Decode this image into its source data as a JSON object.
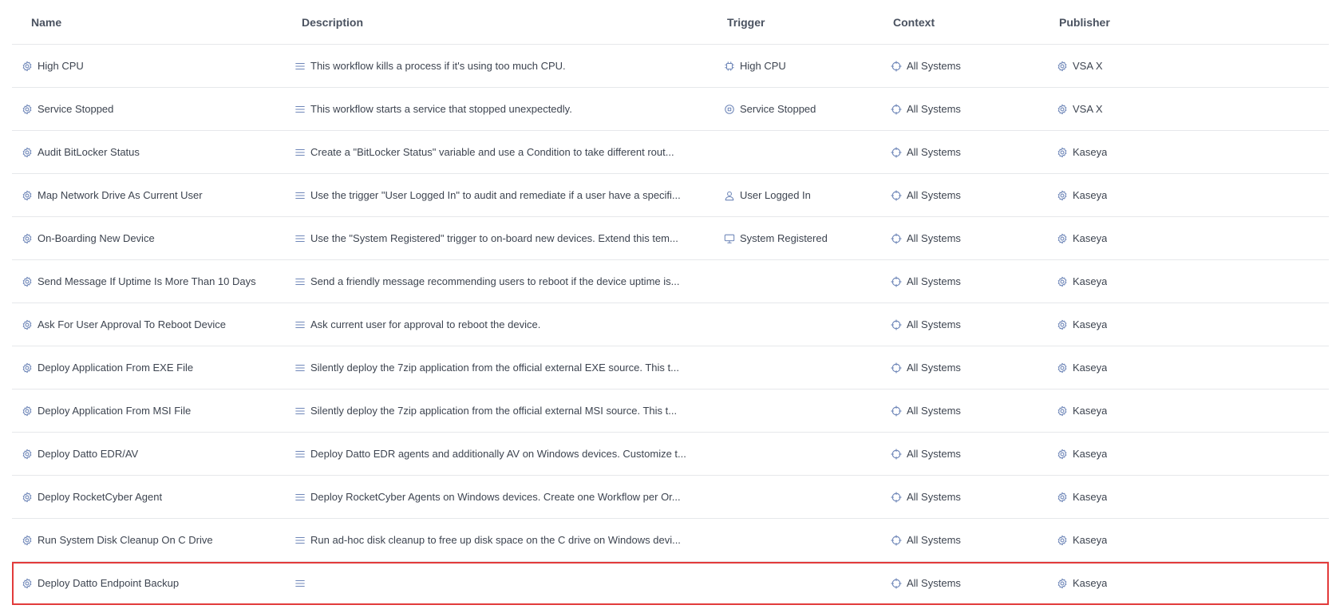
{
  "columns": {
    "name": "Name",
    "description": "Description",
    "trigger": "Trigger",
    "context": "Context",
    "publisher": "Publisher"
  },
  "rows": [
    {
      "name": "High CPU",
      "description": "This workflow kills a process if it's using too much CPU.",
      "trigger": "High CPU",
      "trigger_icon": "cpu-icon",
      "context": "All Systems",
      "publisher": "VSA X"
    },
    {
      "name": "Service Stopped",
      "description": "This workflow starts a service that stopped unexpectedly.",
      "trigger": "Service Stopped",
      "trigger_icon": "stop-circle-icon",
      "context": "All Systems",
      "publisher": "VSA X"
    },
    {
      "name": "Audit BitLocker Status",
      "description": "Create a \"BitLocker Status\" variable and use a Condition to take different rout...",
      "trigger": "",
      "trigger_icon": "",
      "context": "All Systems",
      "publisher": "Kaseya"
    },
    {
      "name": "Map Network Drive As Current User",
      "description": "Use the trigger \"User Logged In\" to audit and remediate if a user have a specifi...",
      "trigger": "User Logged In",
      "trigger_icon": "user-icon",
      "context": "All Systems",
      "publisher": "Kaseya"
    },
    {
      "name": "On-Boarding New Device",
      "description": "Use the \"System Registered\" trigger to on-board new devices. Extend this tem...",
      "trigger": "System Registered",
      "trigger_icon": "monitor-icon",
      "context": "All Systems",
      "publisher": "Kaseya"
    },
    {
      "name": "Send Message If Uptime Is More Than 10 Days",
      "description": "Send a friendly message recommending users to reboot if the device uptime is...",
      "trigger": "",
      "trigger_icon": "",
      "context": "All Systems",
      "publisher": "Kaseya"
    },
    {
      "name": "Ask For User Approval To Reboot Device",
      "description": "Ask current user for approval to reboot the device.",
      "trigger": "",
      "trigger_icon": "",
      "context": "All Systems",
      "publisher": "Kaseya"
    },
    {
      "name": "Deploy Application From EXE File",
      "description": "Silently deploy the 7zip application from the official external EXE source. This t...",
      "trigger": "",
      "trigger_icon": "",
      "context": "All Systems",
      "publisher": "Kaseya"
    },
    {
      "name": "Deploy Application From MSI File",
      "description": "Silently deploy the 7zip application from the official external MSI source. This t...",
      "trigger": "",
      "trigger_icon": "",
      "context": "All Systems",
      "publisher": "Kaseya"
    },
    {
      "name": "Deploy Datto EDR/AV",
      "description": "Deploy Datto EDR agents and additionally AV on Windows devices. Customize t...",
      "trigger": "",
      "trigger_icon": "",
      "context": "All Systems",
      "publisher": "Kaseya"
    },
    {
      "name": "Deploy RocketCyber Agent",
      "description": "Deploy RocketCyber Agents on Windows devices. Create one Workflow per Or...",
      "trigger": "",
      "trigger_icon": "",
      "context": "All Systems",
      "publisher": "Kaseya"
    },
    {
      "name": "Run System Disk Cleanup On C Drive",
      "description": "Run ad-hoc disk cleanup to free up disk space on the C drive on Windows devi...",
      "trigger": "",
      "trigger_icon": "",
      "context": "All Systems",
      "publisher": "Kaseya"
    },
    {
      "name": "Deploy Datto Endpoint Backup",
      "description": "",
      "trigger": "",
      "trigger_icon": "",
      "context": "All Systems",
      "publisher": "Kaseya",
      "selected": true
    }
  ],
  "colors": {
    "icon": "#6e86b8",
    "text": "#3d4450",
    "header": "#4a5260",
    "divider": "#e6e8eb",
    "highlight": "#e23b3b"
  }
}
